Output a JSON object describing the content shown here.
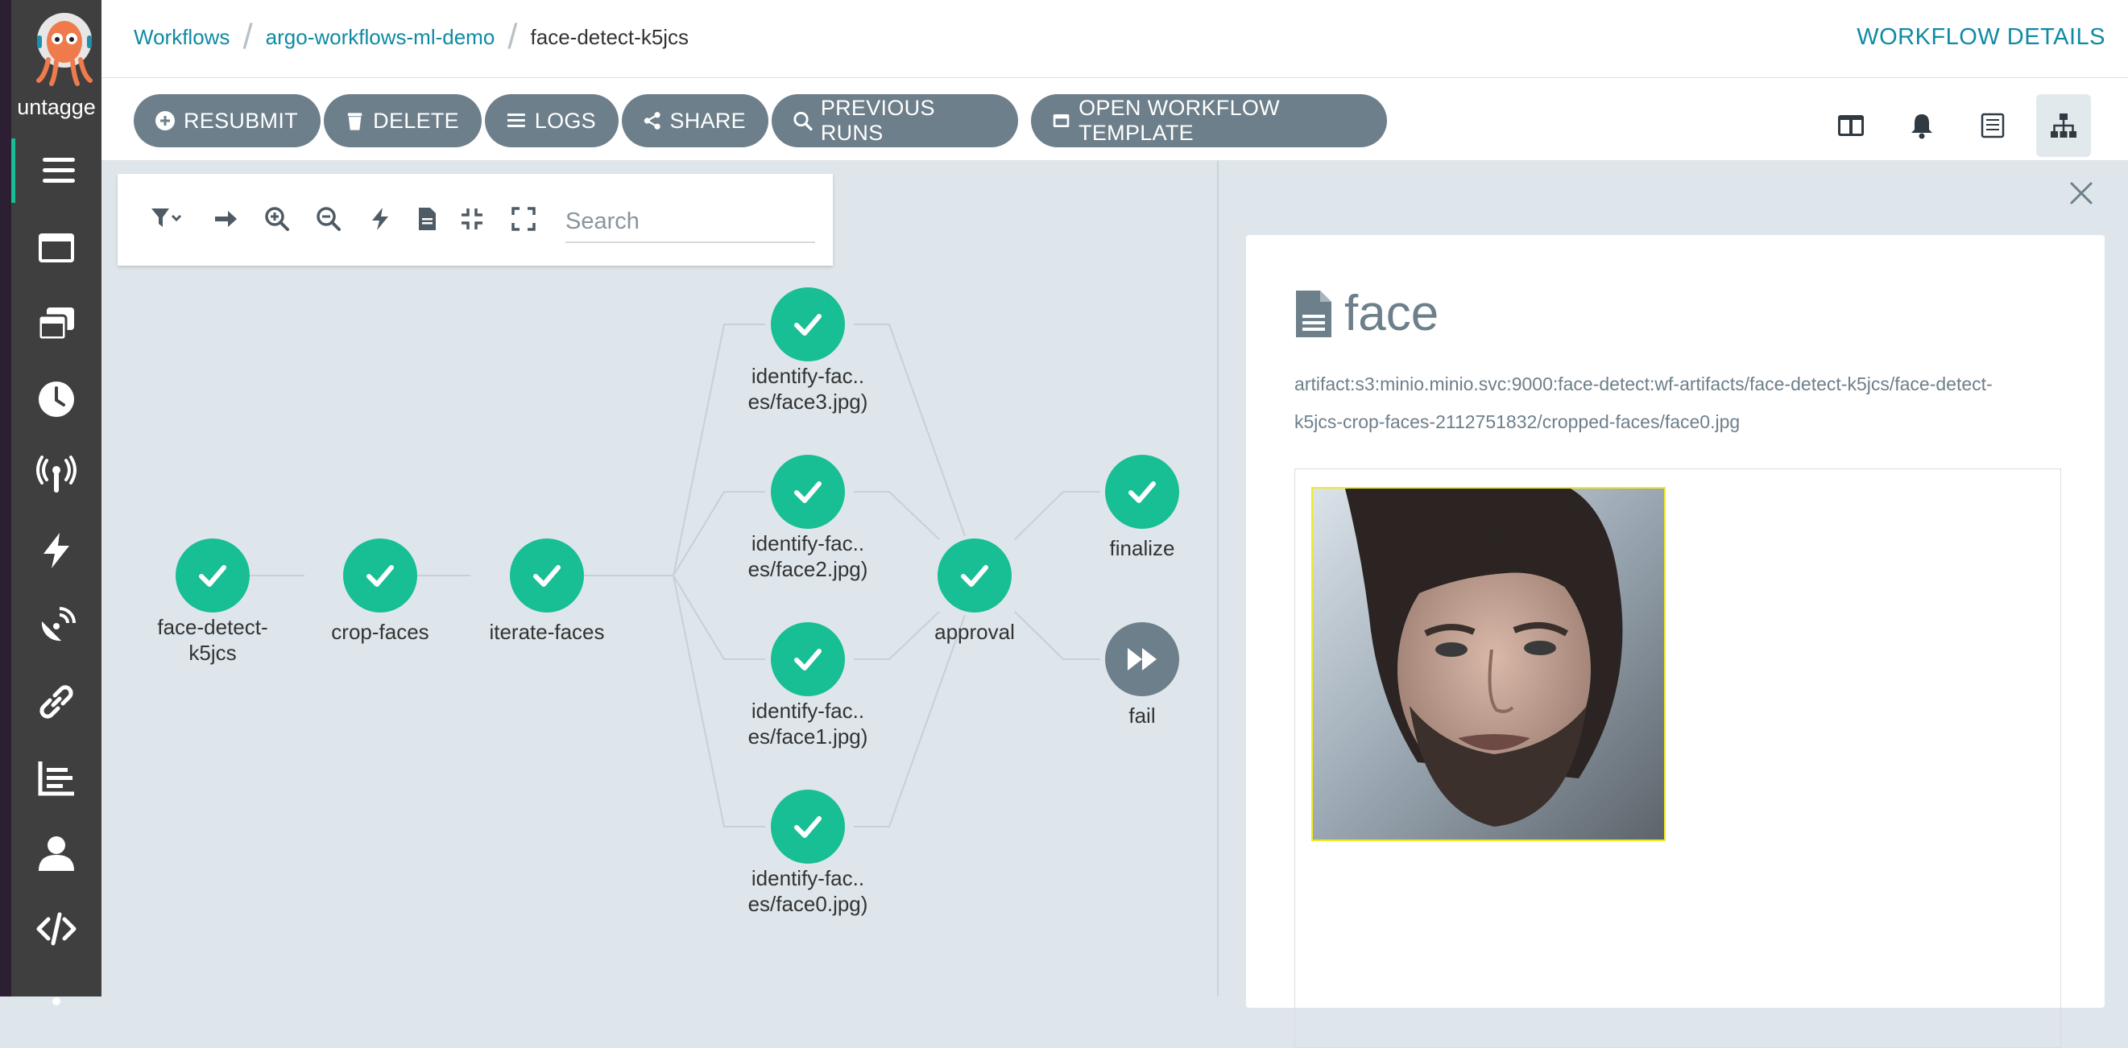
{
  "user": {
    "name": "untagge"
  },
  "breadcrumb": {
    "items": [
      "Workflows",
      "argo-workflows-ml-demo"
    ],
    "current": "face-detect-k5jcs"
  },
  "page_title": "WORKFLOW DETAILS",
  "toolbar": {
    "buttons": [
      {
        "label": "RESUBMIT",
        "icon": "plus-circle-icon"
      },
      {
        "label": "DELETE",
        "icon": "trash-icon"
      },
      {
        "label": "LOGS",
        "icon": "list-icon"
      },
      {
        "label": "SHARE",
        "icon": "share-icon"
      },
      {
        "label": "PREVIOUS RUNS",
        "icon": "search-icon"
      },
      {
        "label": "OPEN WORKFLOW TEMPLATE",
        "icon": "window-icon"
      }
    ],
    "view_icons": [
      "columns-icon",
      "bell-icon",
      "summary-icon",
      "sitemap-icon"
    ]
  },
  "graph": {
    "search_placeholder": "Search",
    "nodes": [
      {
        "id": "root",
        "label": "face-detect-\nk5jcs",
        "status": "succeeded"
      },
      {
        "id": "crop",
        "label": "crop-faces",
        "status": "succeeded"
      },
      {
        "id": "iterate",
        "label": "iterate-faces",
        "status": "succeeded"
      },
      {
        "id": "f3",
        "label": "identify-fac..\nes/face3.jpg)",
        "status": "succeeded"
      },
      {
        "id": "f2",
        "label": "identify-fac..\nes/face2.jpg)",
        "status": "succeeded"
      },
      {
        "id": "f1",
        "label": "identify-fac..\nes/face1.jpg)",
        "status": "succeeded"
      },
      {
        "id": "f0",
        "label": "identify-fac..\nes/face0.jpg)",
        "status": "succeeded"
      },
      {
        "id": "approval",
        "label": "approval",
        "status": "succeeded"
      },
      {
        "id": "finalize",
        "label": "finalize",
        "status": "succeeded"
      },
      {
        "id": "fail",
        "label": "fail",
        "status": "skipped"
      }
    ]
  },
  "artifact": {
    "title": "face",
    "path_line1": "artifact:s3:minio.minio.svc:9000:face-detect:wf-artifacts/face-detect-k5jcs/face-detect-",
    "path_line2": "k5jcs-crop-faces-2112751832/cropped-faces/face0.jpg"
  },
  "colors": {
    "succeeded": "#18be94",
    "skipped": "#6d7f8b",
    "link": "#0f8aa3",
    "sidebar": "#3f3f3f"
  }
}
